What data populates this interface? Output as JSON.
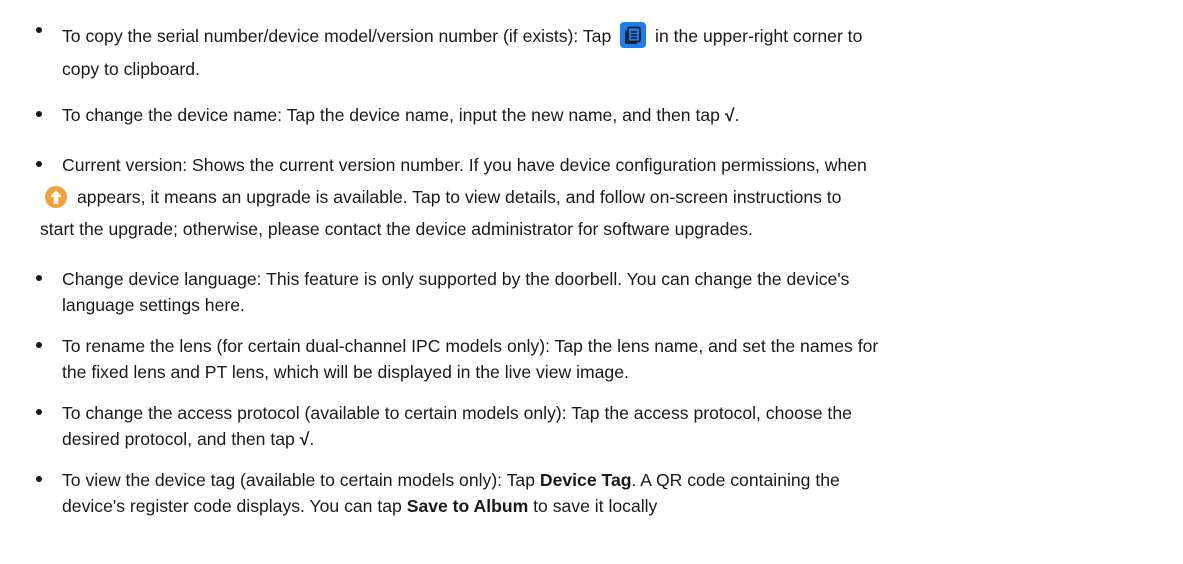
{
  "items": [
    {
      "lines": [
        {
          "before": "To copy the serial number/device model/version number (if exists): Tap",
          "after": "in the upper-right corner to"
        },
        {
          "text": "copy to clipboard."
        }
      ],
      "icon": "copy-icon"
    },
    {
      "text_before": "To change the device name: Tap the device name, input the new name, and then tap ",
      "bold": "√",
      "text_after": "."
    },
    {
      "lines": [
        {
          "text": "Current version: Shows the current version number. If you have device configuration permissions, when"
        },
        {
          "after": "appears, it means an upgrade is available. Tap to view details, and follow on-screen instructions to"
        },
        {
          "text": "start the upgrade; otherwise, please contact the device administrator for software upgrades."
        }
      ],
      "icon": "upgrade-arrow-icon"
    },
    {
      "lines": [
        {
          "text": "Change device language: This feature is only supported by the doorbell. You can change the device's"
        },
        {
          "text": "language settings here."
        }
      ]
    },
    {
      "lines": [
        {
          "text": "To rename the lens (for certain dual-channel IPC models only): Tap the lens name, and set the names for"
        },
        {
          "text": "the fixed lens and PT lens, which will be displayed in the live view image."
        }
      ]
    },
    {
      "lines": [
        {
          "text": "To change the access protocol (available to certain models only): Tap the access protocol, choose the"
        },
        {
          "before": "desired protocol, and then tap ",
          "bold": "√",
          "after": "."
        }
      ]
    },
    {
      "lines": [
        {
          "before": "To view the device tag (available to certain models only): Tap ",
          "bold": "Device Tag",
          "after": ". A QR code containing the"
        },
        {
          "before": "device's register code displays. You can tap ",
          "bold": "Save to Album",
          "after": " to save it locally"
        }
      ]
    }
  ],
  "colors": {
    "copy_icon_bg": "#1c7df0",
    "upgrade_icon_bg": "#f4a13a",
    "text": "#1a1a1a"
  }
}
